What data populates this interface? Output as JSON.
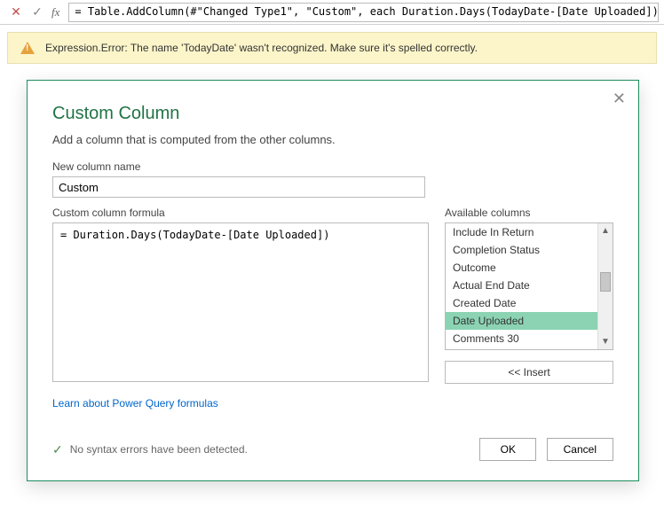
{
  "formula_bar": {
    "formula": "= Table.AddColumn(#\"Changed Type1\", \"Custom\", each Duration.Days(TodayDate-[Date Uploaded]))"
  },
  "error": {
    "text": "Expression.Error: The name 'TodayDate' wasn't recognized.  Make sure it's spelled correctly."
  },
  "dialog": {
    "title": "Custom Column",
    "subtitle": "Add a column that is computed from the other columns.",
    "new_column_label": "New column name",
    "new_column_value": "Custom",
    "formula_label": "Custom column formula",
    "formula_value": "= Duration.Days(TodayDate-[Date Uploaded])",
    "available_label": "Available columns",
    "available_columns": [
      "Include In Return",
      "Completion Status",
      "Outcome",
      "Actual End Date",
      "Created Date",
      "Date Uploaded",
      "Comments 30"
    ],
    "selected_column_index": 5,
    "insert_label": "<< Insert",
    "learn_link": "Learn about Power Query formulas",
    "status_text": "No syntax errors have been detected.",
    "ok_label": "OK",
    "cancel_label": "Cancel"
  }
}
